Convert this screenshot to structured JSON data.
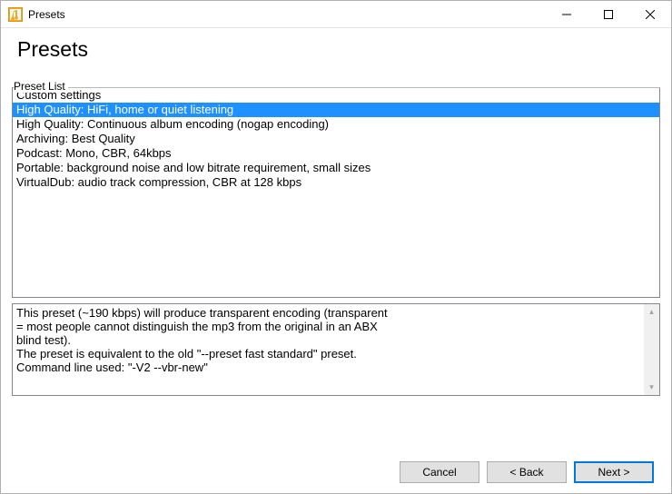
{
  "window": {
    "title": "Presets"
  },
  "header": {
    "title": "Presets"
  },
  "presetList": {
    "label": "Preset List",
    "selectedIndex": 1,
    "items": [
      "Custom settings",
      "High Quality: HiFi, home or quiet listening",
      "High Quality: Continuous album encoding (nogap encoding)",
      "Archiving: Best Quality",
      "Podcast: Mono, CBR, 64kbps",
      "Portable: background noise and low bitrate requirement, small sizes",
      "VirtualDub: audio track compression, CBR at 128 kbps"
    ]
  },
  "description": {
    "lines": [
      "This preset (~190 kbps) will produce transparent encoding (transparent",
      "= most people cannot distinguish the mp3 from the original in an ABX",
      "blind test).",
      "The preset is equivalent to the old \"--preset fast standard\" preset.",
      "Command line used: \"-V2 --vbr-new\""
    ]
  },
  "buttons": {
    "cancel": "Cancel",
    "back": "< Back",
    "next": "Next >"
  }
}
